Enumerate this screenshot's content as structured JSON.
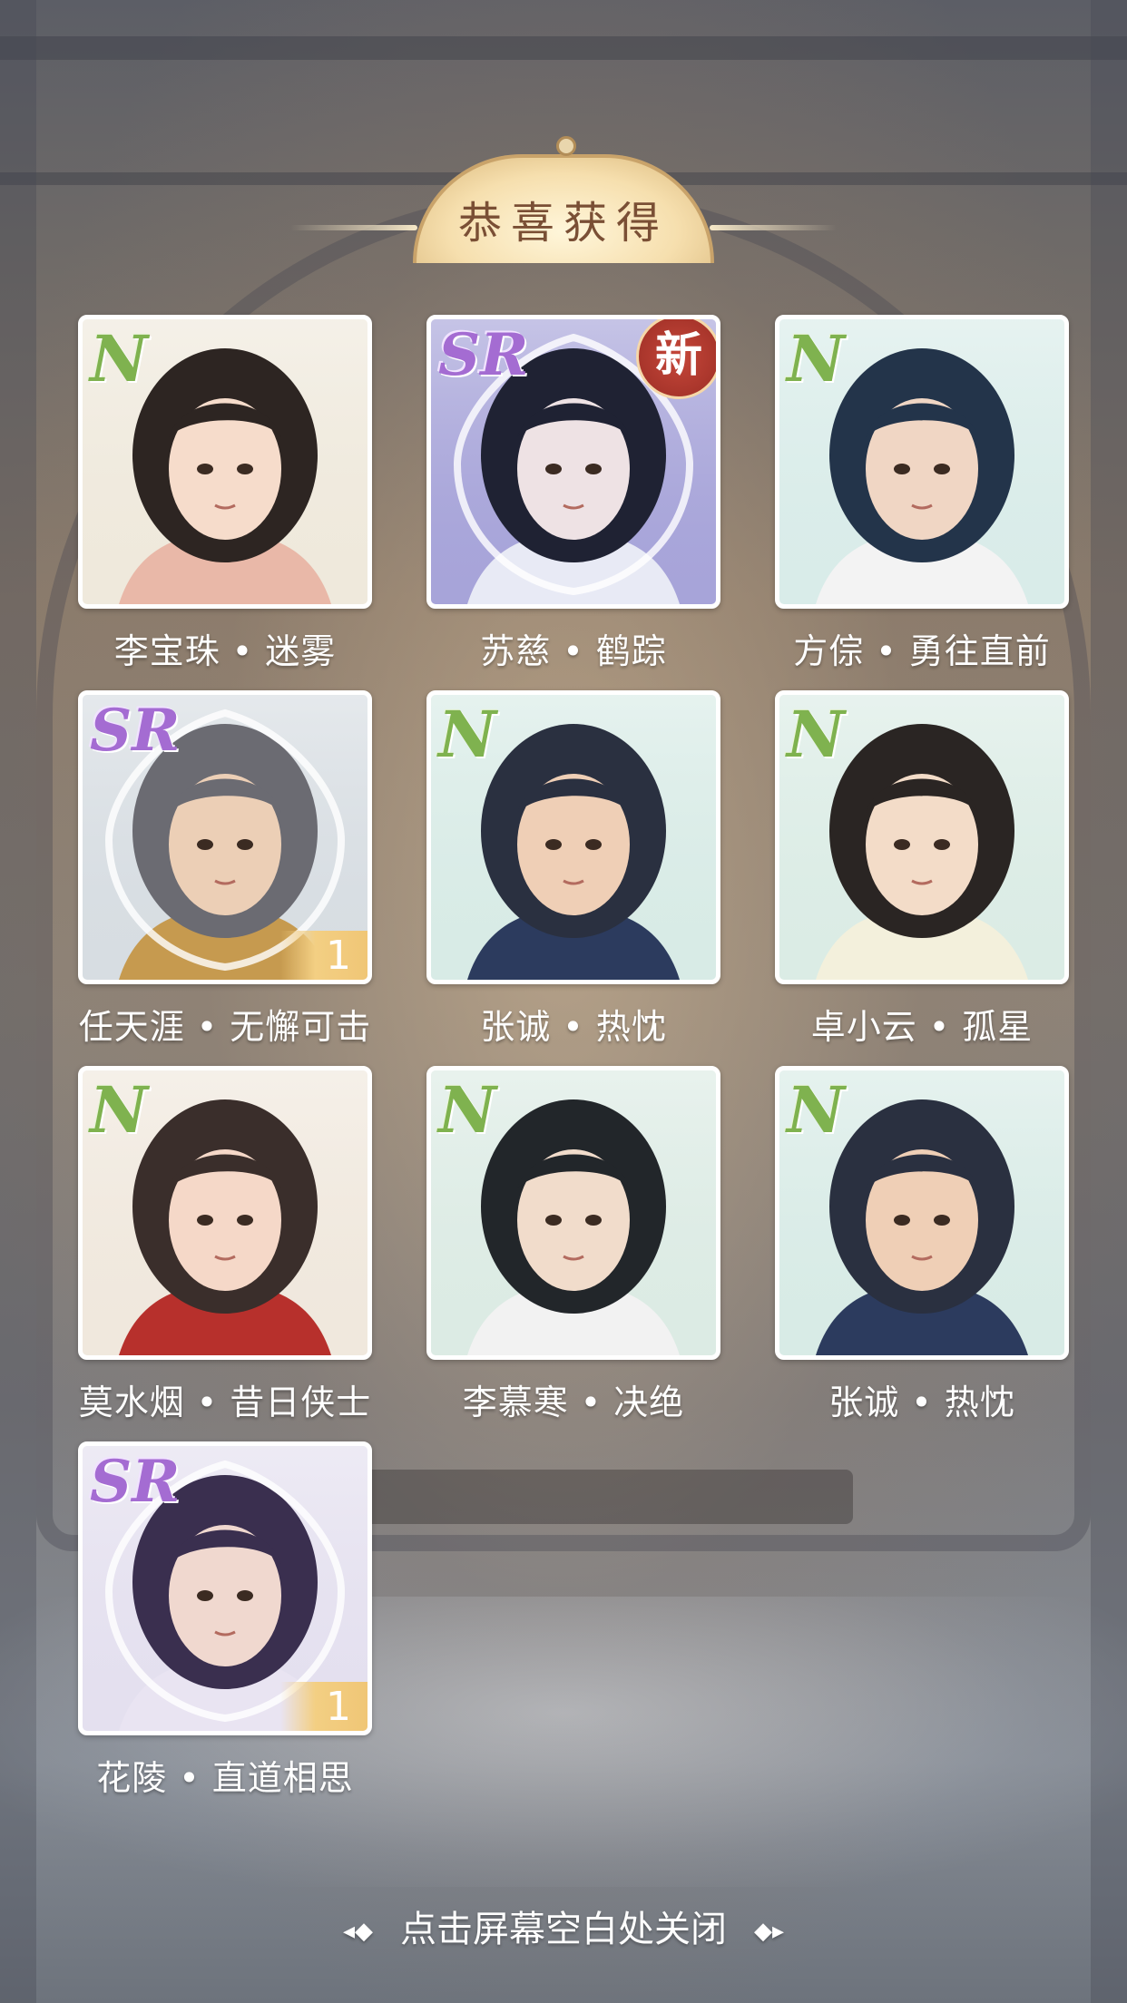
{
  "header": {
    "title": "恭喜获得"
  },
  "cards": [
    {
      "rarity": "N",
      "name": "李宝珠 • 迷雾",
      "bg": "#efe9dc",
      "hair": "#2d2522",
      "skin": "#f6dccb",
      "cloth": "#e9b8a8"
    },
    {
      "rarity": "SR",
      "name": "苏慈 • 鹤踪",
      "bg": "#a7a4d9",
      "hair": "#1f2233",
      "skin": "#eee2e4",
      "cloth": "#e8eaf5",
      "new_badge": "新"
    },
    {
      "rarity": "N",
      "name": "方倧 • 勇往直前",
      "bg": "#d9ece9",
      "hair": "#23344a",
      "skin": "#f0d6c4",
      "cloth": "#f3f3f3"
    },
    {
      "rarity": "SR",
      "name": "任天涯 • 无懈可击",
      "bg": "#d7dde2",
      "hair": "#6b6b72",
      "skin": "#eccfb6",
      "cloth": "#c69a4f",
      "count": "1"
    },
    {
      "rarity": "N",
      "name": "张诚 • 热忱",
      "bg": "#d8ebe6",
      "hair": "#2a3040",
      "skin": "#efcfb6",
      "cloth": "#2c3b5e"
    },
    {
      "rarity": "N",
      "name": "卓小云 • 孤星",
      "bg": "#dbece5",
      "hair": "#2a2523",
      "skin": "#f3dcc8",
      "cloth": "#f3f0dc"
    },
    {
      "rarity": "N",
      "name": "莫水烟 • 昔日侠士",
      "bg": "#f0e8dd",
      "hair": "#3a2e2b",
      "skin": "#f5d8c8",
      "cloth": "#b7302c"
    },
    {
      "rarity": "N",
      "name": "李慕寒 • 决绝",
      "bg": "#dcebe4",
      "hair": "#22262a",
      "skin": "#f1dccb",
      "cloth": "#f2f2f2"
    },
    {
      "rarity": "N",
      "name": "张诚 • 热忱",
      "bg": "#d8ebe6",
      "hair": "#2a3040",
      "skin": "#efcfb6",
      "cloth": "#2c3b5e"
    },
    {
      "rarity": "SR",
      "name": "花陵 • 直道相思",
      "bg": "#e4e0ef",
      "hair": "#3a2f4f",
      "skin": "#f0d8cf",
      "cloth": "#e9e4f2",
      "count": "1"
    }
  ],
  "footer": {
    "hint": "点击屏幕空白处关闭",
    "deco_left": "◂◆",
    "deco_right": "◆▸"
  }
}
